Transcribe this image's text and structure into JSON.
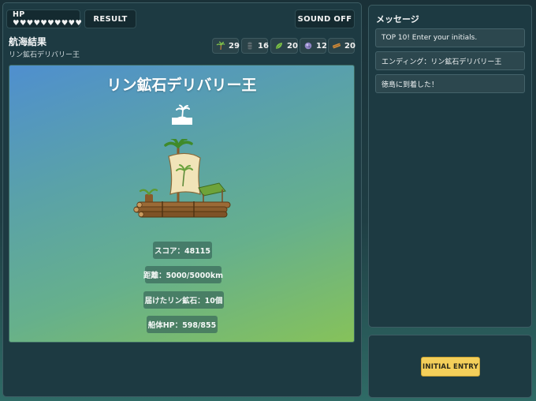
{
  "header": {
    "hp_label": "HP ♥♥♥♥♥♥♥♥♥♥",
    "result_tab": "RESULT",
    "sound_button": "SOUND OFF"
  },
  "page": {
    "title": "航海結果",
    "subtitle": "リン鉱石デリバリー王"
  },
  "resources": [
    {
      "icon": "palm-tree-icon",
      "value": "29"
    },
    {
      "icon": "barrel-icon",
      "value": "16"
    },
    {
      "icon": "leaf-icon",
      "value": "20"
    },
    {
      "icon": "ore-icon",
      "value": "12"
    },
    {
      "icon": "plank-icon",
      "value": "20"
    }
  ],
  "stage": {
    "title": "リン鉱石デリバリー王",
    "island_icon": "island-palm-icon",
    "raft_image": "raft-with-palm-sail",
    "stats": {
      "score": "スコア：48115",
      "distance": "距離：5000/5000km",
      "ore": "届けたリン鉱石：10個",
      "hull": "船体HP：598/855"
    }
  },
  "messages": {
    "heading": "メッセージ",
    "items": [
      "TOP 10! Enter your initials.",
      "エンディング：リン鉱石デリバリー王",
      "徳島に到着した！"
    ]
  },
  "entry": {
    "button": "INITIAL ENTRY"
  },
  "colors": {
    "panel_bg": "#1d3a42",
    "accent_button": "#f4cf5a",
    "stage_gradient_start": "#4f8fcf",
    "stage_gradient_end": "#86c25a"
  }
}
